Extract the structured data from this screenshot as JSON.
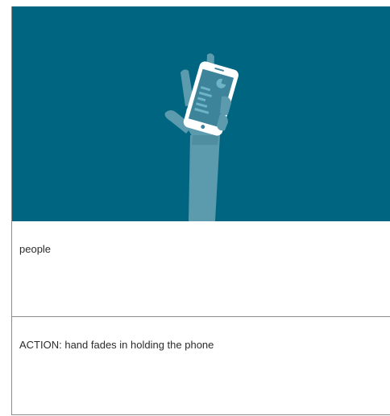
{
  "storyboard": {
    "scene": {
      "background_color": "#006580",
      "arm_color": "#5c9aad",
      "phone_frame_color": "#ffffff",
      "phone_screen_color": "#3d8399",
      "icon": "hand-holding-phone-icon"
    },
    "caption": "people",
    "action": "ACTION: hand fades in holding the phone"
  }
}
